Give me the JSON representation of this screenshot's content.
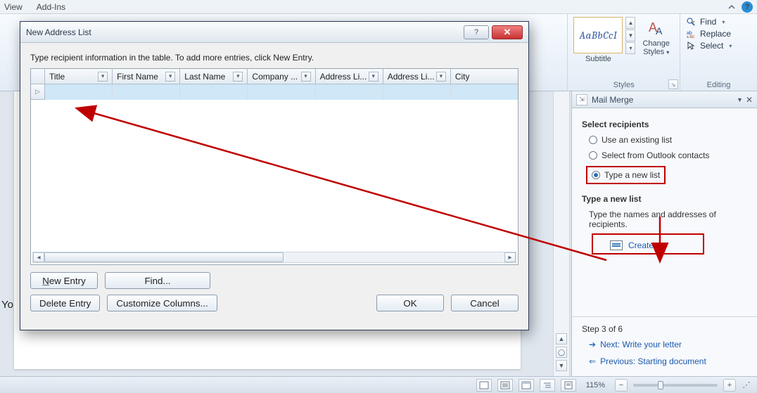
{
  "menu": {
    "view": "View",
    "addins": "Add-Ins"
  },
  "ribbon": {
    "style_preview": "AaBbCcI",
    "style_sublabel": "Subtitle",
    "styles_group": "Styles",
    "change_styles": "Change\nStyles",
    "editing_group": "Editing",
    "find": "Find",
    "replace": "Replace",
    "select": "Select"
  },
  "pane": {
    "title": "Mail Merge",
    "select_recipients": "Select recipients",
    "opt_existing": "Use an existing list",
    "opt_outlook": "Select from Outlook contacts",
    "opt_new": "Type a new list",
    "type_new_heading": "Type a new list",
    "type_new_desc": "Type the names and addresses of recipients.",
    "create": "Create...",
    "step": "Step 3 of 6",
    "next": "Next: Write your letter",
    "prev": "Previous: Starting document"
  },
  "dialog": {
    "title": "New Address List",
    "instruction": "Type recipient information in the table.  To add more entries, click New Entry.",
    "columns": [
      "Title",
      "First Name",
      "Last Name",
      "Company ...",
      "Address Li...",
      "Address Li...",
      "City"
    ],
    "new_entry": "New Entry",
    "delete_entry": "Delete Entry",
    "find": "Find...",
    "customize": "Customize Columns...",
    "ok": "OK",
    "cancel": "Cancel"
  },
  "statusbar": {
    "zoom": "115%"
  },
  "doc": {
    "fragment": "Yo"
  }
}
